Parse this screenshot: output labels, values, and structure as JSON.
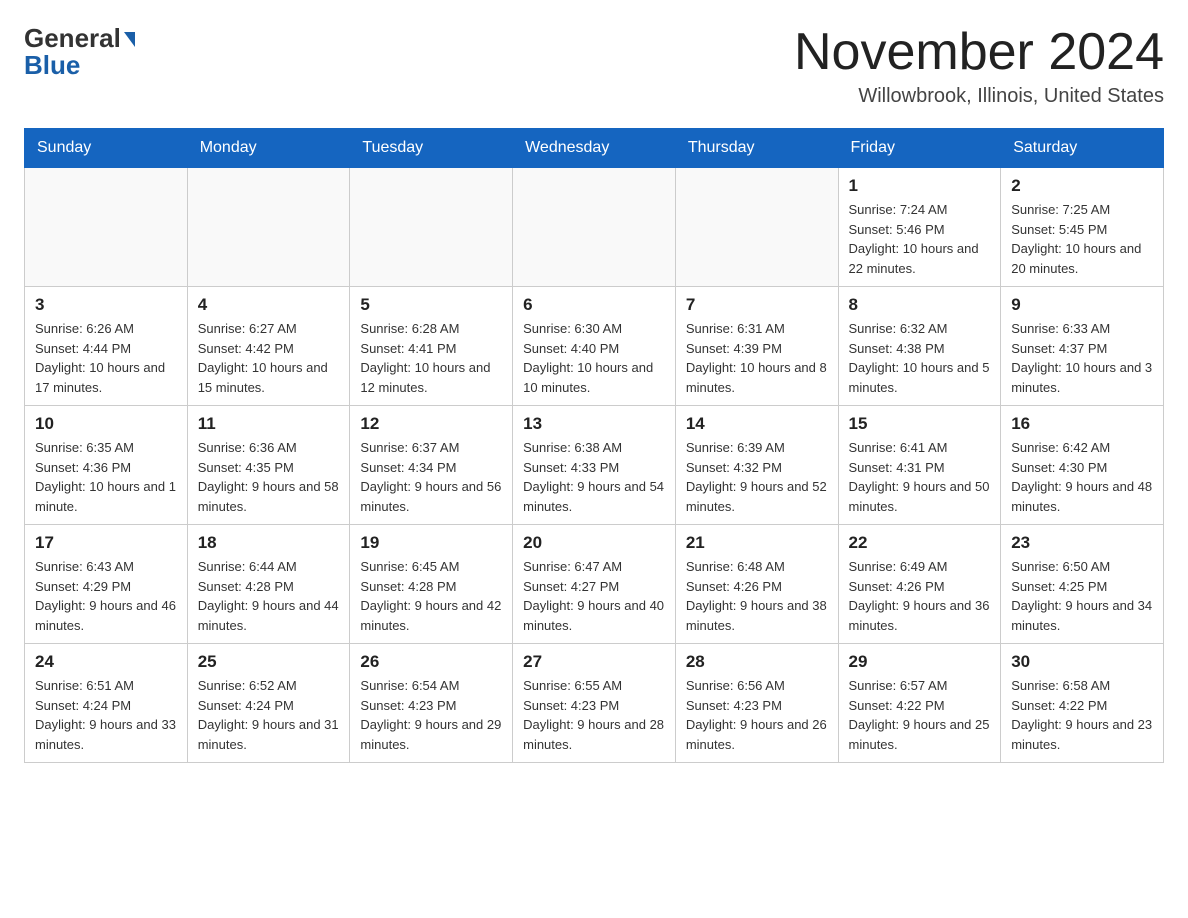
{
  "header": {
    "title": "November 2024",
    "location": "Willowbrook, Illinois, United States",
    "logo_general": "General",
    "logo_blue": "Blue"
  },
  "weekdays": [
    "Sunday",
    "Monday",
    "Tuesday",
    "Wednesday",
    "Thursday",
    "Friday",
    "Saturday"
  ],
  "weeks": [
    [
      {
        "day": "",
        "sunrise": "",
        "sunset": "",
        "daylight": ""
      },
      {
        "day": "",
        "sunrise": "",
        "sunset": "",
        "daylight": ""
      },
      {
        "day": "",
        "sunrise": "",
        "sunset": "",
        "daylight": ""
      },
      {
        "day": "",
        "sunrise": "",
        "sunset": "",
        "daylight": ""
      },
      {
        "day": "",
        "sunrise": "",
        "sunset": "",
        "daylight": ""
      },
      {
        "day": "1",
        "sunrise": "Sunrise: 7:24 AM",
        "sunset": "Sunset: 5:46 PM",
        "daylight": "Daylight: 10 hours and 22 minutes."
      },
      {
        "day": "2",
        "sunrise": "Sunrise: 7:25 AM",
        "sunset": "Sunset: 5:45 PM",
        "daylight": "Daylight: 10 hours and 20 minutes."
      }
    ],
    [
      {
        "day": "3",
        "sunrise": "Sunrise: 6:26 AM",
        "sunset": "Sunset: 4:44 PM",
        "daylight": "Daylight: 10 hours and 17 minutes."
      },
      {
        "day": "4",
        "sunrise": "Sunrise: 6:27 AM",
        "sunset": "Sunset: 4:42 PM",
        "daylight": "Daylight: 10 hours and 15 minutes."
      },
      {
        "day": "5",
        "sunrise": "Sunrise: 6:28 AM",
        "sunset": "Sunset: 4:41 PM",
        "daylight": "Daylight: 10 hours and 12 minutes."
      },
      {
        "day": "6",
        "sunrise": "Sunrise: 6:30 AM",
        "sunset": "Sunset: 4:40 PM",
        "daylight": "Daylight: 10 hours and 10 minutes."
      },
      {
        "day": "7",
        "sunrise": "Sunrise: 6:31 AM",
        "sunset": "Sunset: 4:39 PM",
        "daylight": "Daylight: 10 hours and 8 minutes."
      },
      {
        "day": "8",
        "sunrise": "Sunrise: 6:32 AM",
        "sunset": "Sunset: 4:38 PM",
        "daylight": "Daylight: 10 hours and 5 minutes."
      },
      {
        "day": "9",
        "sunrise": "Sunrise: 6:33 AM",
        "sunset": "Sunset: 4:37 PM",
        "daylight": "Daylight: 10 hours and 3 minutes."
      }
    ],
    [
      {
        "day": "10",
        "sunrise": "Sunrise: 6:35 AM",
        "sunset": "Sunset: 4:36 PM",
        "daylight": "Daylight: 10 hours and 1 minute."
      },
      {
        "day": "11",
        "sunrise": "Sunrise: 6:36 AM",
        "sunset": "Sunset: 4:35 PM",
        "daylight": "Daylight: 9 hours and 58 minutes."
      },
      {
        "day": "12",
        "sunrise": "Sunrise: 6:37 AM",
        "sunset": "Sunset: 4:34 PM",
        "daylight": "Daylight: 9 hours and 56 minutes."
      },
      {
        "day": "13",
        "sunrise": "Sunrise: 6:38 AM",
        "sunset": "Sunset: 4:33 PM",
        "daylight": "Daylight: 9 hours and 54 minutes."
      },
      {
        "day": "14",
        "sunrise": "Sunrise: 6:39 AM",
        "sunset": "Sunset: 4:32 PM",
        "daylight": "Daylight: 9 hours and 52 minutes."
      },
      {
        "day": "15",
        "sunrise": "Sunrise: 6:41 AM",
        "sunset": "Sunset: 4:31 PM",
        "daylight": "Daylight: 9 hours and 50 minutes."
      },
      {
        "day": "16",
        "sunrise": "Sunrise: 6:42 AM",
        "sunset": "Sunset: 4:30 PM",
        "daylight": "Daylight: 9 hours and 48 minutes."
      }
    ],
    [
      {
        "day": "17",
        "sunrise": "Sunrise: 6:43 AM",
        "sunset": "Sunset: 4:29 PM",
        "daylight": "Daylight: 9 hours and 46 minutes."
      },
      {
        "day": "18",
        "sunrise": "Sunrise: 6:44 AM",
        "sunset": "Sunset: 4:28 PM",
        "daylight": "Daylight: 9 hours and 44 minutes."
      },
      {
        "day": "19",
        "sunrise": "Sunrise: 6:45 AM",
        "sunset": "Sunset: 4:28 PM",
        "daylight": "Daylight: 9 hours and 42 minutes."
      },
      {
        "day": "20",
        "sunrise": "Sunrise: 6:47 AM",
        "sunset": "Sunset: 4:27 PM",
        "daylight": "Daylight: 9 hours and 40 minutes."
      },
      {
        "day": "21",
        "sunrise": "Sunrise: 6:48 AM",
        "sunset": "Sunset: 4:26 PM",
        "daylight": "Daylight: 9 hours and 38 minutes."
      },
      {
        "day": "22",
        "sunrise": "Sunrise: 6:49 AM",
        "sunset": "Sunset: 4:26 PM",
        "daylight": "Daylight: 9 hours and 36 minutes."
      },
      {
        "day": "23",
        "sunrise": "Sunrise: 6:50 AM",
        "sunset": "Sunset: 4:25 PM",
        "daylight": "Daylight: 9 hours and 34 minutes."
      }
    ],
    [
      {
        "day": "24",
        "sunrise": "Sunrise: 6:51 AM",
        "sunset": "Sunset: 4:24 PM",
        "daylight": "Daylight: 9 hours and 33 minutes."
      },
      {
        "day": "25",
        "sunrise": "Sunrise: 6:52 AM",
        "sunset": "Sunset: 4:24 PM",
        "daylight": "Daylight: 9 hours and 31 minutes."
      },
      {
        "day": "26",
        "sunrise": "Sunrise: 6:54 AM",
        "sunset": "Sunset: 4:23 PM",
        "daylight": "Daylight: 9 hours and 29 minutes."
      },
      {
        "day": "27",
        "sunrise": "Sunrise: 6:55 AM",
        "sunset": "Sunset: 4:23 PM",
        "daylight": "Daylight: 9 hours and 28 minutes."
      },
      {
        "day": "28",
        "sunrise": "Sunrise: 6:56 AM",
        "sunset": "Sunset: 4:23 PM",
        "daylight": "Daylight: 9 hours and 26 minutes."
      },
      {
        "day": "29",
        "sunrise": "Sunrise: 6:57 AM",
        "sunset": "Sunset: 4:22 PM",
        "daylight": "Daylight: 9 hours and 25 minutes."
      },
      {
        "day": "30",
        "sunrise": "Sunrise: 6:58 AM",
        "sunset": "Sunset: 4:22 PM",
        "daylight": "Daylight: 9 hours and 23 minutes."
      }
    ]
  ]
}
